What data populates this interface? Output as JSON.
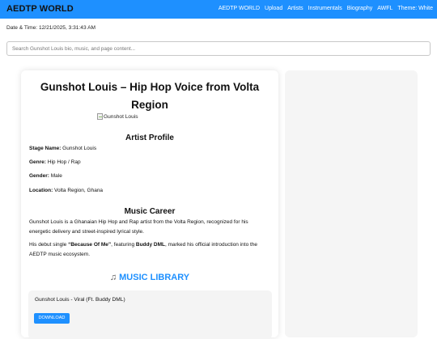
{
  "header": {
    "brand": "AEDTP WORLD",
    "nav": [
      "AEDTP WORLD",
      "Upload",
      "Artists",
      "Instrumentals",
      "Biography",
      "AWFL",
      "Theme: White"
    ]
  },
  "datetime": "Date & Time: 12/21/2025, 3:31:43 AM",
  "search": {
    "placeholder": "Search Gunshot Louis bio, music, and page content..."
  },
  "article": {
    "title": "Gunshot Louis – Hip Hop Voice from Volta Region",
    "image_alt": "Gunshot Louis",
    "profile_heading": "Artist Profile",
    "profile": [
      {
        "label": "Stage Name:",
        "value": " Gunshot Louis"
      },
      {
        "label": "Genre:",
        "value": " Hip Hop / Rap"
      },
      {
        "label": "Gender:",
        "value": " Male"
      },
      {
        "label": "Location:",
        "value": " Volta Region, Ghana"
      }
    ],
    "career_heading": "Music Career",
    "career_p1": "Gunshot Louis is a Ghanaian Hip Hop and Rap artist from the Volta Region, recognized for his energetic delivery and street-inspired lyrical style.",
    "career_p2": {
      "t1": "His debut single ",
      "song": "“Because Of Me”",
      "t2": ", featuring ",
      "feat": "Buddy DML",
      "t3": ", marked his official introduction into the AEDTP music ecosystem."
    }
  },
  "library": {
    "icon": "music-notes-icon",
    "heading": "MUSIC LIBRARY",
    "tracks": [
      {
        "title": "Gunshot Louis - Viral (Ft. Buddy DML)",
        "button": "DOWNLOAD"
      }
    ]
  },
  "colors": {
    "accent": "#1e90ff",
    "panel": "#f5f5f5"
  }
}
